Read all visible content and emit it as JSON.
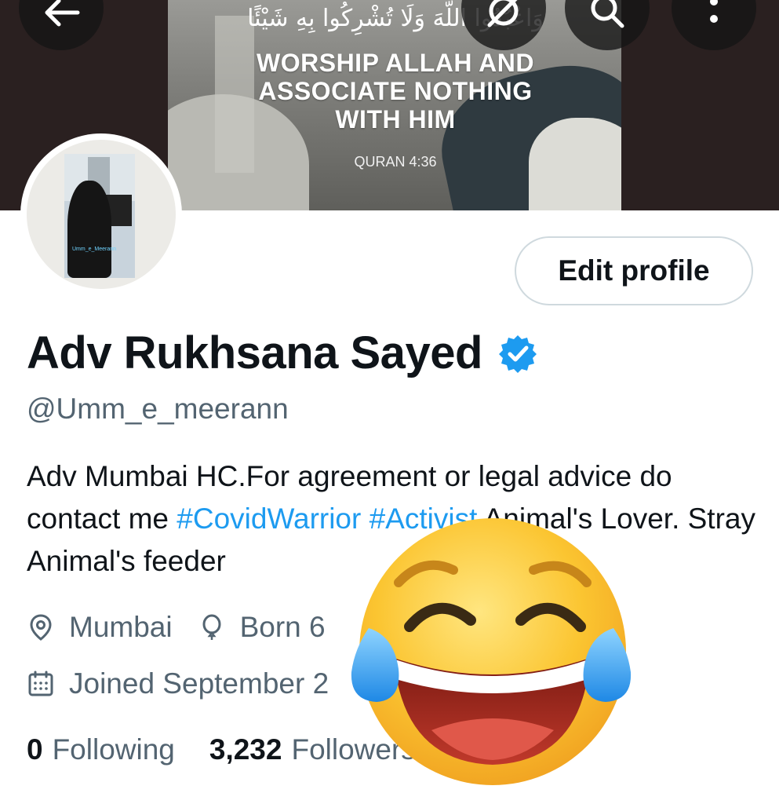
{
  "header": {
    "back_icon": "arrow-left-icon",
    "grok_icon": "grok-icon",
    "search_icon": "search-icon",
    "more_icon": "more-vertical-icon"
  },
  "banner": {
    "arabic_text": "وَاعْبُدُوا اللَّهَ وَلَا تُشْرِكُوا بِهِ شَيْئًا",
    "headline_line1": "WORSHIP ALLAH AND",
    "headline_line2": "ASSOCIATE NOTHING",
    "headline_line3": "WITH HIM",
    "reference": "QURAN 4:36"
  },
  "avatar": {
    "caption": "Umm_e_Meerann"
  },
  "profile": {
    "edit_label": "Edit profile",
    "display_name": "Adv Rukhsana Sayed",
    "handle": "@Umm_e_meerann",
    "bio_part1": "Adv Mumbai HC.For agreement or legal advice do contact me ",
    "bio_hashtag": "#CovidWarrior #Activist",
    "bio_part2": " Animal's Lover. Stray Animal's feeder",
    "location": "Mumbai",
    "birth": "Born 6",
    "joined": "Joined September 2"
  },
  "stats": {
    "following_count": "0",
    "following_label": "Following",
    "followers_count": "3,232",
    "followers_label": "Followers"
  },
  "colors": {
    "accent": "#1d9bf0",
    "muted": "#536471",
    "text": "#0f1419",
    "border": "#cfd9de"
  },
  "overlay": {
    "emoji": "face-with-tears-of-joy"
  }
}
